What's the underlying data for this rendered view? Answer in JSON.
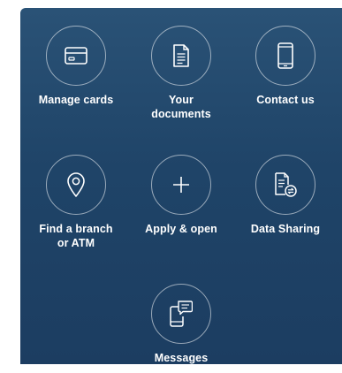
{
  "menu": {
    "items": [
      {
        "label": "Manage cards",
        "icon": "credit-card-icon"
      },
      {
        "label": "Your\ndocuments",
        "icon": "document-icon"
      },
      {
        "label": "Contact us",
        "icon": "mobile-phone-icon"
      },
      {
        "label": "Find a branch\nor ATM",
        "icon": "map-pin-icon"
      },
      {
        "label": "Apply & open",
        "icon": "plus-icon"
      },
      {
        "label": "Data Sharing",
        "icon": "data-sharing-icon"
      },
      {
        "label": "Messages",
        "icon": "messages-icon"
      }
    ]
  },
  "colors": {
    "panel_top": "#2a5276",
    "panel_bottom": "#1c3d61",
    "foreground": "#ffffff"
  }
}
